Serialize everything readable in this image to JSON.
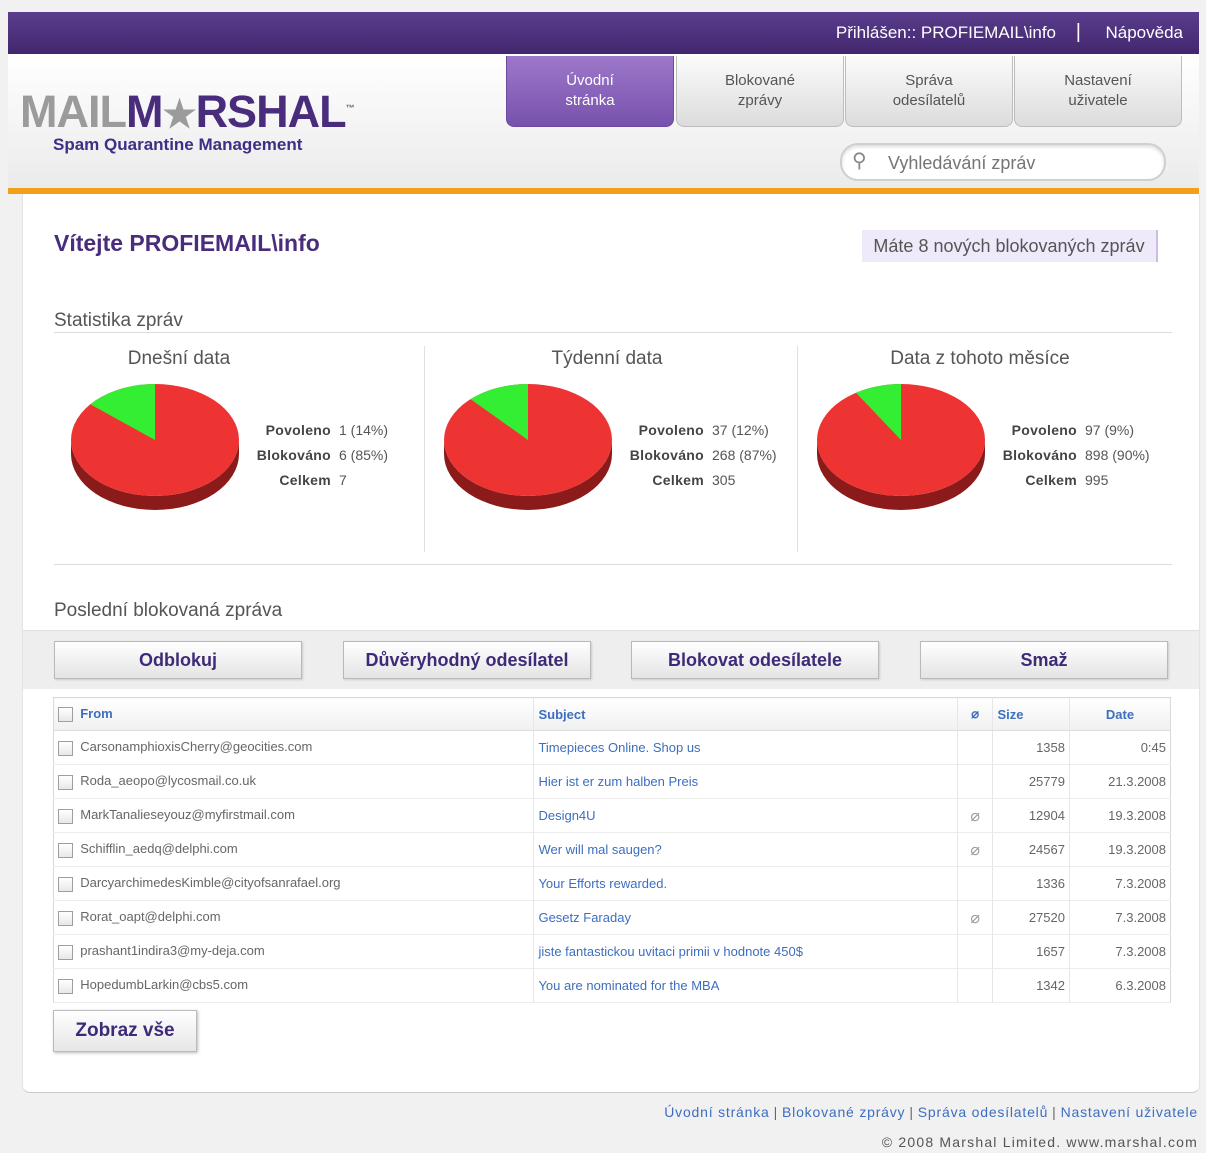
{
  "topbar": {
    "login": "Přihlášen:: PROFIEMAIL\\info",
    "separator": "|",
    "help": "Nápověda"
  },
  "logo": {
    "mail": "MAIL",
    "star": "★",
    "marshal": "RSHAL",
    "m": "M",
    "subtitle": "Spam Quarantine Management",
    "tm": "™"
  },
  "tabs": [
    {
      "label": "Úvodní\nstránka",
      "active": true
    },
    {
      "label": "Blokované\nzprávy",
      "active": false
    },
    {
      "label": "Správa\nodesílatelů",
      "active": false
    },
    {
      "label": "Nastavení\nuživatele",
      "active": false
    }
  ],
  "search": {
    "placeholder": "Vyhledávání zpráv",
    "icon": "search-icon"
  },
  "welcome": "Vítejte PROFIEMAIL\\info",
  "notice": "Máte 8 nových blokovaných zpráv",
  "stats": {
    "title": "Statistika zpráv",
    "colors": {
      "allowed": "#33ee33",
      "blocked": "#ee3333",
      "blocked_side": "#8b1a1a"
    },
    "panels": [
      {
        "title": "Dnešní data",
        "allowed_label": "Povoleno",
        "allowed": "1 (14%)",
        "blocked_label": "Blokováno",
        "blocked": "6 (85%)",
        "total_label": "Celkem",
        "total": "7",
        "allowed_fraction": 0.14
      },
      {
        "title": "Týdenní data",
        "allowed_label": "Povoleno",
        "allowed": "37 (12%)",
        "blocked_label": "Blokováno",
        "blocked": "268 (87%)",
        "total_label": "Celkem",
        "total": "305",
        "allowed_fraction": 0.12
      },
      {
        "title": "Data z tohoto měsíce",
        "allowed_label": "Povoleno",
        "allowed": "97 (9%)",
        "blocked_label": "Blokováno",
        "blocked": "898 (90%)",
        "total_label": "Celkem",
        "total": "995",
        "allowed_fraction": 0.09
      }
    ]
  },
  "recent": {
    "title": "Poslední blokovaná zpráva",
    "buttons": [
      "Odblokuj",
      "Důvěryhodný odesílatel",
      "Blokovat odesílatele",
      "Smaž"
    ],
    "columns": {
      "from": "From",
      "subject": "Subject",
      "attachment_icon": "paperclip-icon",
      "size": "Size",
      "date": "Date"
    },
    "rows": [
      {
        "from": "CarsonamphioxisCherry@geocities.com",
        "subject": "Timepieces Online. Shop us",
        "attachment": false,
        "size": "1358",
        "date": "0:45"
      },
      {
        "from": "Roda_aeopo@lycosmail.co.uk",
        "subject": "Hier ist er zum halben Preis",
        "attachment": false,
        "size": "25779",
        "date": "21.3.2008"
      },
      {
        "from": "MarkTanalieseyouz@myfirstmail.com",
        "subject": "Design4U",
        "attachment": true,
        "size": "12904",
        "date": "19.3.2008"
      },
      {
        "from": "Schifflin_aedq@delphi.com",
        "subject": "Wer will mal saugen?",
        "attachment": true,
        "size": "24567",
        "date": "19.3.2008"
      },
      {
        "from": "DarcyarchimedesKimble@cityofsanrafael.org",
        "subject": "Your Efforts rewarded.",
        "attachment": false,
        "size": "1336",
        "date": "7.3.2008"
      },
      {
        "from": "Rorat_oapt@delphi.com",
        "subject": "Gesetz Faraday",
        "attachment": true,
        "size": "27520",
        "date": "7.3.2008"
      },
      {
        "from": "prashant1indira3@my-deja.com",
        "subject": "jiste fantastickou uvitaci primii v hodnote 450$",
        "attachment": false,
        "size": "1657",
        "date": "7.3.2008"
      },
      {
        "from": "HopedumbLarkin@cbs5.com",
        "subject": "You are nominated for the MBA",
        "attachment": false,
        "size": "1342",
        "date": "6.3.2008"
      }
    ],
    "show_all": "Zobraz vše"
  },
  "footer": {
    "links": [
      "Úvodní stránka",
      "Blokované zprávy",
      "Správa odesílatelů",
      "Nastavení uživatele"
    ],
    "separator": "|",
    "copyright": "© 2008 Marshal Limited. www.marshal.com"
  }
}
